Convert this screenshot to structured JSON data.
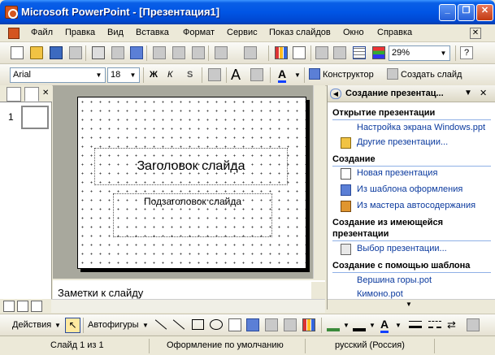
{
  "window": {
    "title": "Microsoft PowerPoint - [Презентация1]",
    "minimize": "_",
    "restore": "❐",
    "close": "✕"
  },
  "menu": [
    "Файл",
    "Правка",
    "Вид",
    "Вставка",
    "Формат",
    "Сервис",
    "Показ слайдов",
    "Окно",
    "Справка"
  ],
  "toolbar": {
    "zoom": "29%"
  },
  "formatting": {
    "font": "Arial",
    "size": "18",
    "bold": "Ж",
    "italic": "К",
    "shadow": "S",
    "designer": "Конструктор",
    "new_slide": "Создать слайд"
  },
  "slides": {
    "number": "1"
  },
  "slide": {
    "title_placeholder": "Заголовок слайда",
    "subtitle_placeholder": "Подзаголовок слайда"
  },
  "notes": {
    "placeholder": "Заметки к слайду"
  },
  "taskpane": {
    "title": "Создание презентац...",
    "sections": [
      {
        "heading": "Открытие презентации",
        "links": [
          "Настройка экрана Windows.ppt",
          "Другие презентации..."
        ]
      },
      {
        "heading": "Создание",
        "links": [
          "Новая презентация",
          "Из шаблона оформления",
          "Из мастера автосодержания"
        ]
      },
      {
        "heading": "Создание из имеющейся презентации",
        "links": [
          "Выбор презентации..."
        ]
      },
      {
        "heading": "Создание с помощью шаблона",
        "links": [
          "Вершина горы.pot",
          "Кимоно.pot"
        ]
      }
    ]
  },
  "drawing": {
    "actions": "Действия",
    "autoshapes": "Автофигуры"
  },
  "status": {
    "slide": "Слайд 1 из 1",
    "design": "Оформление по умолчанию",
    "language": "русский (Россия)"
  }
}
